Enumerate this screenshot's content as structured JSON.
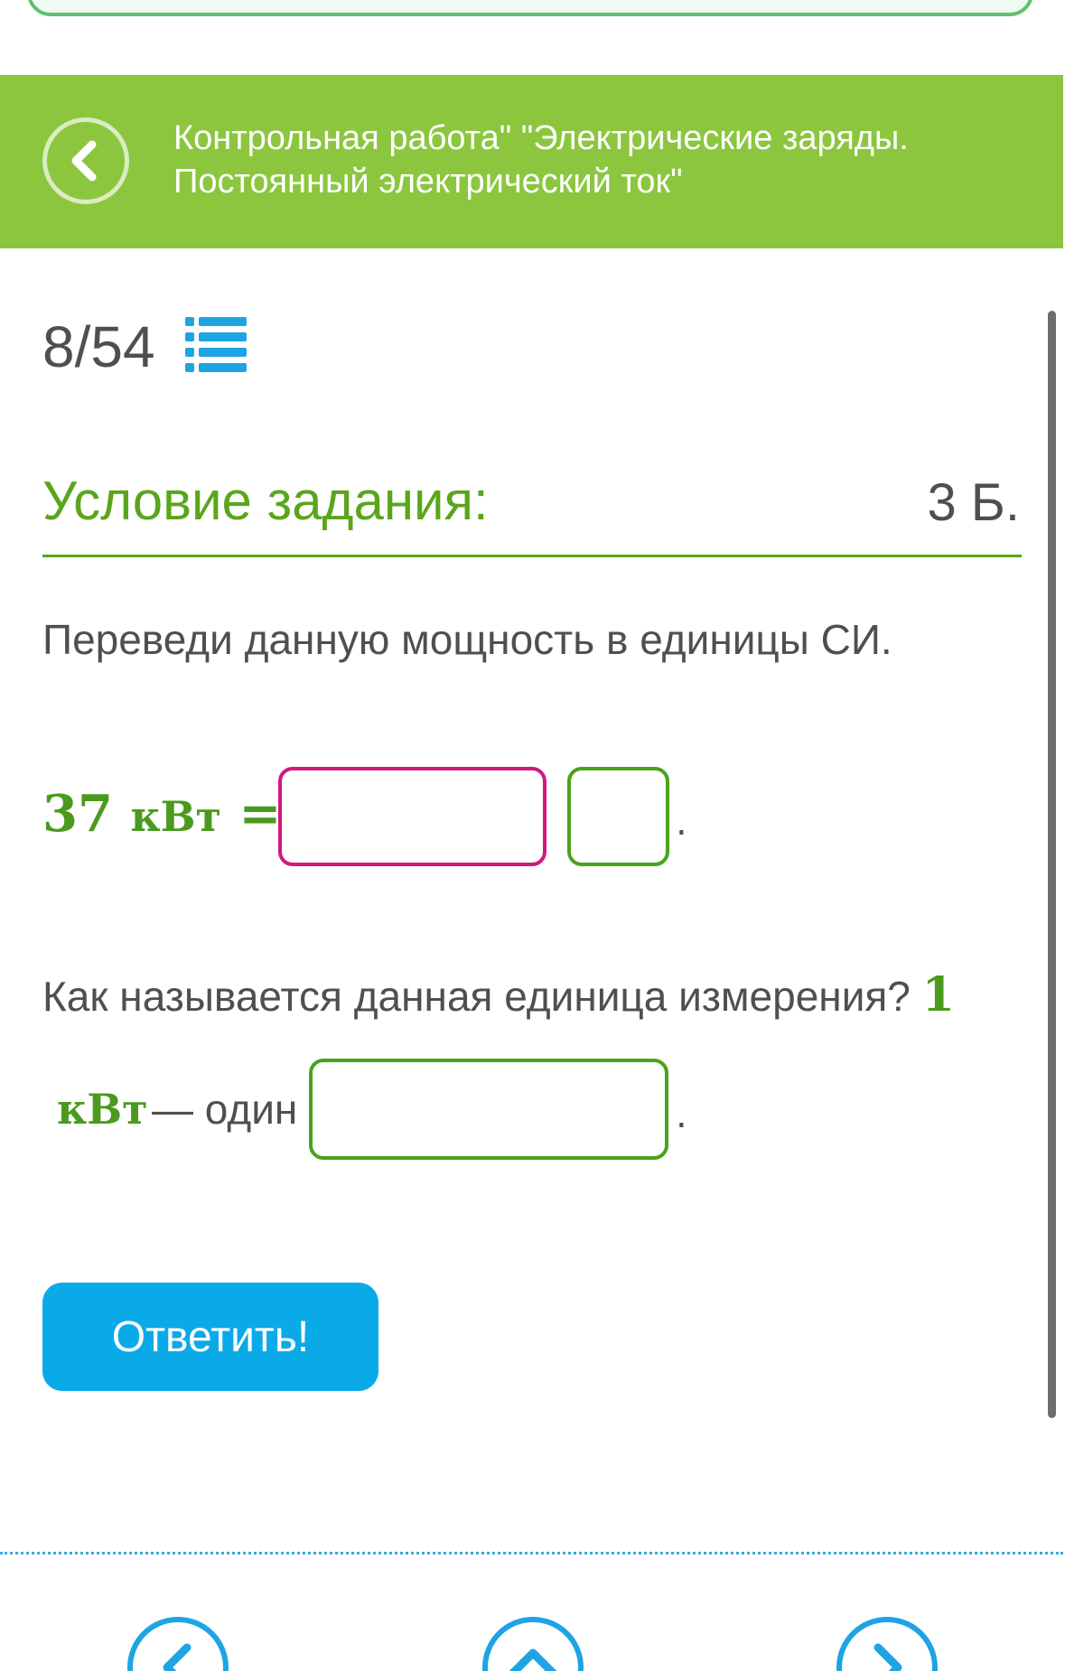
{
  "header": {
    "title_line1": "Контрольная работа\" \"Электрические заряды.",
    "title_line2": "Постоянный электрический ток\""
  },
  "progress": {
    "counter": "8/54"
  },
  "task": {
    "section_title": "Условие задания:",
    "points": "3 Б.",
    "instruction": "Переведи данную мощность в единицы СИ.",
    "equation": {
      "value": "37",
      "unit": "кВт",
      "equals": "=",
      "period": "."
    },
    "question": "Как называется данная единица измерения?",
    "question_number": "1",
    "line2_unit": "кВт",
    "line2_text": "— один",
    "line2_period": "."
  },
  "buttons": {
    "answer_label": "Ответить!"
  },
  "icons": {
    "back": "chevron-left-icon",
    "list": "list-icon",
    "nav_prev": "chevron-left-icon",
    "nav_up": "chevron-up-icon",
    "nav_next": "chevron-right-icon"
  },
  "colors": {
    "header_green": "#8cc63f",
    "title_green": "#5aa61b",
    "accent_blue": "#0aaae8",
    "magenta_input": "#d1187f",
    "green_input": "#4aa31c"
  }
}
